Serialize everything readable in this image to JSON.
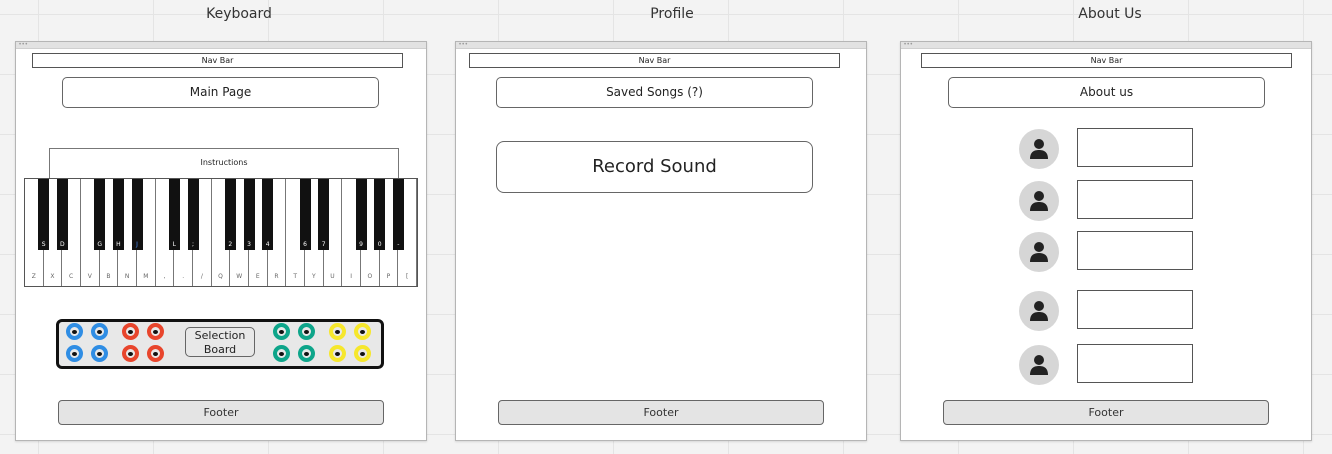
{
  "frames": {
    "keyboard": {
      "title": "Keyboard",
      "nav": "Nav Bar",
      "main_button": "Main Page",
      "instructions": "Instructions",
      "white_keys": [
        "Z",
        "X",
        "C",
        "V",
        "B",
        "N",
        "M",
        ",",
        ".",
        "/",
        "Q",
        "W",
        "E",
        "R",
        "T",
        "Y",
        "U",
        "I",
        "O",
        "P",
        "["
      ],
      "black_keys": [
        "S",
        "D",
        "G",
        "H",
        "J",
        "L",
        ";",
        "2",
        "3",
        "4",
        "6",
        "7",
        "9",
        "0",
        "-"
      ],
      "selection_label": "Selection Board",
      "footer": "Footer"
    },
    "profile": {
      "title": "Profile",
      "nav": "Nav Bar",
      "main_button": "Saved Songs (?)",
      "record_button": "Record Sound",
      "footer": "Footer"
    },
    "about": {
      "title": "About Us",
      "nav": "Nav Bar",
      "main_button": "About us",
      "member_count": 5,
      "footer": "Footer"
    }
  },
  "knob_colors": {
    "blue": "#2f8de4",
    "red": "#e8452c",
    "green": "#0ea58a",
    "yellow": "#f6e72c"
  },
  "icons": {
    "avatar": "user-icon"
  }
}
